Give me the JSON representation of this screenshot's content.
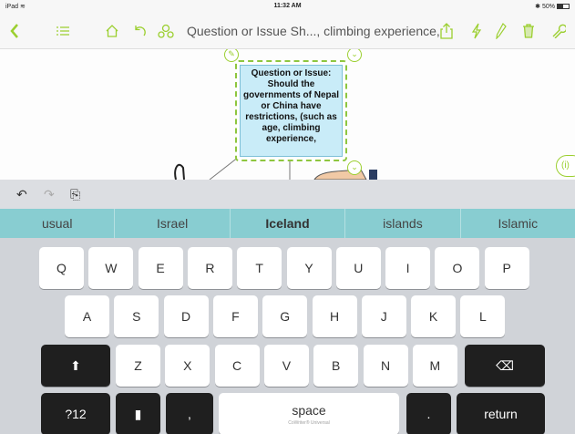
{
  "status_bar": {
    "device": "iPad ≋",
    "time": "11:32 AM",
    "battery": "✱ 50%"
  },
  "toolbar": {
    "back_icon": "chevron-left-icon",
    "list_icon": "outline-list-icon",
    "home_icon": "home-icon",
    "undo_icon": "undo-icon",
    "hierarchy_icon": "hierarchy-icon",
    "title": "Question or Issue  Sh..., climbing experience,",
    "share_icon": "share-icon",
    "lightning_icon": "lightning-icon",
    "pen_icon": "pen-icon",
    "trash_icon": "trash-icon",
    "wrench_icon": "wrench-icon",
    "accent_color": "#9bcf2f"
  },
  "canvas": {
    "node_text": "Question or Issue: Should the governments of Nepal or China have restrictions, (such as age, climbing experience,",
    "node_fill": "#c9ecf8",
    "node_border": "#8ec63f",
    "handle_edit": "✎",
    "handle_collapse": "⌄",
    "info_label": "(i)"
  },
  "keyboard": {
    "shortcuts": {
      "undo": "↶",
      "redo": "↷",
      "paste": "⎘"
    },
    "suggestions": [
      "usual",
      "Israel",
      "Iceland",
      "islands",
      "Islamic"
    ],
    "suggestion_color": "#88cdd1",
    "row1": [
      "Q",
      "W",
      "E",
      "R",
      "T",
      "Y",
      "U",
      "I",
      "O",
      "P"
    ],
    "row2": [
      "A",
      "S",
      "D",
      "F",
      "G",
      "H",
      "J",
      "K",
      "L"
    ],
    "row3": [
      "Z",
      "X",
      "C",
      "V",
      "B",
      "N",
      "M"
    ],
    "shift": "⬆",
    "backspace": "⌫",
    "numbers": "?12",
    "clipboard": "▮",
    "comma": ",",
    "space": "space",
    "space_sub": "CoWriter® Universal",
    "period": ".",
    "return": "return"
  }
}
